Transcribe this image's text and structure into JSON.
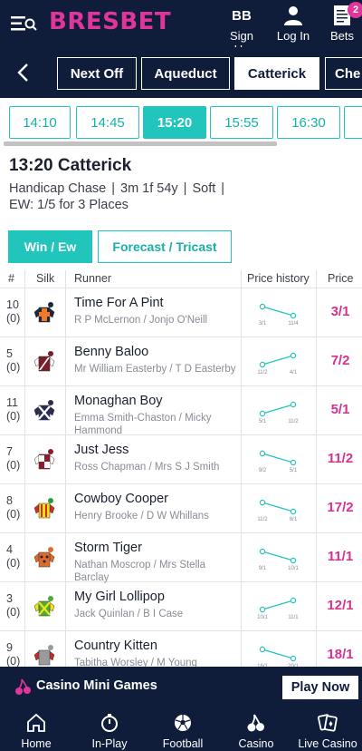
{
  "header": {
    "logo": "BRESBET",
    "signup_label": "Sign Up",
    "signup_initials": "BB",
    "login_label": "Log In",
    "bets_label": "Bets",
    "bets_count": "2"
  },
  "venue_tabs": [
    "Next Off",
    "Aqueduct",
    "Catterick",
    "Che"
  ],
  "active_venue": "Catterick",
  "times": [
    "14:10",
    "14:45",
    "15:20",
    "15:55",
    "16:30",
    ""
  ],
  "active_time": "15:20",
  "race": {
    "title": "13:20 Catterick",
    "type": "Handicap Chase",
    "distance": "3m 1f 54y",
    "going": "Soft",
    "ew": "EW: 1/5 for 3 Places"
  },
  "markets": {
    "win_ew": "Win / Ew",
    "forecast": "Forecast / Tricast"
  },
  "columns": {
    "num": "#",
    "silk": "Silk",
    "runner": "Runner",
    "history": "Price history",
    "price": "Price"
  },
  "runners": [
    {
      "num": "10",
      "draw": "(0)",
      "name": "Time For A Pint",
      "connections": "R P McLernon / Jonjo O'Neill",
      "hist_from": "3/1",
      "hist_to": "11/4",
      "price": "3/1"
    },
    {
      "num": "5",
      "draw": "(0)",
      "name": "Benny Baloo",
      "connections": "Mr William Easterby / T D Easterby",
      "hist_from": "11/2",
      "hist_to": "4/1",
      "price": "7/2"
    },
    {
      "num": "11",
      "draw": "(0)",
      "name": "Monaghan Boy",
      "connections": "Emma Smith-Chaston / Micky Hammond",
      "hist_from": "5/1",
      "hist_to": "11/2",
      "price": "5/1"
    },
    {
      "num": "7",
      "draw": "(0)",
      "name": "Just Jess",
      "connections": "Ross Chapman / Mrs S J Smith",
      "hist_from": "9/2",
      "hist_to": "5/1",
      "price": "11/2"
    },
    {
      "num": "8",
      "draw": "(0)",
      "name": "Cowboy Cooper",
      "connections": "Henry Brooke / D W Whillans",
      "hist_from": "11/2",
      "hist_to": "8/1",
      "price": "17/2"
    },
    {
      "num": "4",
      "draw": "(0)",
      "name": "Storm Tiger",
      "connections": "Nathan Moscrop / Mrs Stella Barclay",
      "hist_from": "9/1",
      "hist_to": "10/1",
      "price": "11/1"
    },
    {
      "num": "3",
      "draw": "(0)",
      "name": "My Girl Lollipop",
      "connections": "Jack Quinlan / B I Case",
      "hist_from": "10/1",
      "hist_to": "11/1",
      "price": "12/1"
    },
    {
      "num": "9",
      "draw": "(0)",
      "name": "Country Kitten",
      "connections": "Tabitha Worsley / M Young",
      "hist_from": "16/1",
      "hist_to": "20/1",
      "price": "18/1"
    }
  ],
  "promo": {
    "title": "Casino Mini Games",
    "button": "Play Now"
  },
  "bottom_nav": [
    "Home",
    "In-Play",
    "Football",
    "Casino",
    "Live Casino"
  ],
  "colors": {
    "navy": "#0f1c3a",
    "pink": "#e0359a",
    "teal": "#22c5bb"
  }
}
